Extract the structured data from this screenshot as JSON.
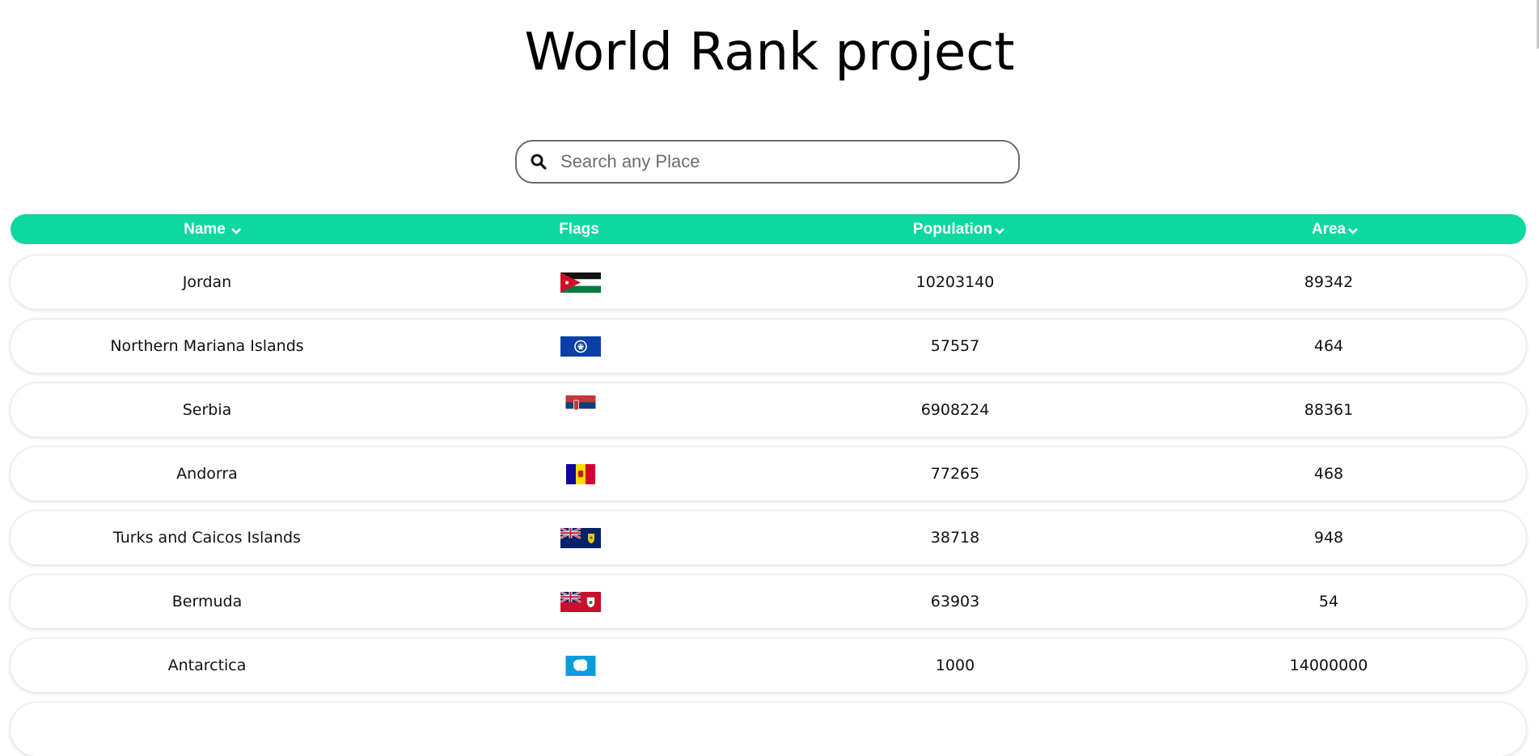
{
  "page": {
    "title": "World Rank project"
  },
  "search": {
    "placeholder": "Search any Place",
    "value": ""
  },
  "table": {
    "headers": {
      "name": "Name",
      "flags": "Flags",
      "population": "Population",
      "area": "Area"
    },
    "rows": [
      {
        "name": "Jordan",
        "flag": "jordan-flag",
        "population": "10203140",
        "area": "89342"
      },
      {
        "name": "Northern Mariana Islands",
        "flag": "northern-mariana-islands-flag",
        "population": "57557",
        "area": "464"
      },
      {
        "name": "Serbia",
        "flag": "serbia-flag",
        "population": "6908224",
        "area": "88361"
      },
      {
        "name": "Andorra",
        "flag": "andorra-flag",
        "population": "77265",
        "area": "468"
      },
      {
        "name": "Turks and Caicos Islands",
        "flag": "turks-and-caicos-islands-flag",
        "population": "38718",
        "area": "948"
      },
      {
        "name": "Bermuda",
        "flag": "bermuda-flag",
        "population": "63903",
        "area": "54"
      },
      {
        "name": "Antarctica",
        "flag": "antarctica-flag",
        "population": "1000",
        "area": "14000000"
      }
    ]
  },
  "colors": {
    "header_bg": "#0cd8a0",
    "header_text": "#ffffff"
  }
}
